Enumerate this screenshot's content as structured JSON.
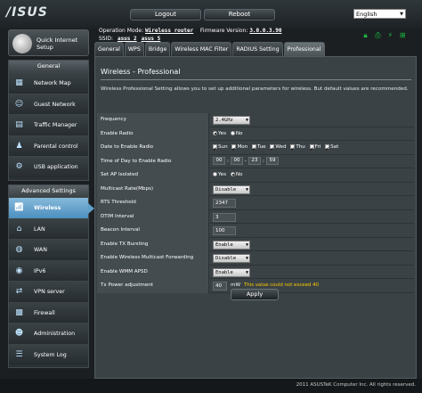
{
  "header": {
    "logo": "/ISUS",
    "logout_label": "Logout",
    "reboot_label": "Reboot",
    "language": "English",
    "operation_mode_label": "Operation Mode:",
    "operation_mode_value": "Wireless router",
    "firmware_label": "Firmware Version:",
    "firmware_value": "3.0.0.3.90",
    "ssid_label": "SSID:",
    "ssid_1": "asus_2",
    "ssid_2": "asus_5",
    "status_icons": [
      "lock-icon",
      "printer-icon",
      "usb-icon",
      "network-icon"
    ]
  },
  "sidebar": {
    "qis_label": "Quick Internet Setup",
    "general_title": "General",
    "general_items": [
      {
        "label": "Network Map",
        "icon": "network-map-icon"
      },
      {
        "label": "Guest Network",
        "icon": "guest-network-icon"
      },
      {
        "label": "Traffic Manager",
        "icon": "traffic-manager-icon"
      },
      {
        "label": "Parental control",
        "icon": "parental-control-icon"
      },
      {
        "label": "USB application",
        "icon": "usb-application-icon"
      }
    ],
    "advanced_title": "Advanced Settings",
    "advanced_items": [
      {
        "label": "Wireless",
        "icon": "wireless-icon",
        "active": true
      },
      {
        "label": "LAN",
        "icon": "lan-icon"
      },
      {
        "label": "WAN",
        "icon": "wan-icon"
      },
      {
        "label": "IPv6",
        "icon": "ipv6-icon"
      },
      {
        "label": "VPN server",
        "icon": "vpn-server-icon"
      },
      {
        "label": "Firewall",
        "icon": "firewall-icon"
      },
      {
        "label": "Administration",
        "icon": "administration-icon"
      },
      {
        "label": "System Log",
        "icon": "system-log-icon"
      }
    ]
  },
  "tabs": [
    "General",
    "WPS",
    "Bridge",
    "Wireless MAC Filter",
    "RADIUS Setting",
    "Professional"
  ],
  "active_tab": "Professional",
  "panel": {
    "title": "Wireless - Professional",
    "description": "Wireless Professional Setting allows you to set up additional parameters for wireless. But default values are recommended.",
    "apply_label": "Apply"
  },
  "settings": {
    "frequency": {
      "label": "Frequency",
      "value": "2.4GHz"
    },
    "enable_radio": {
      "label": "Enable Radio",
      "yes": "Yes",
      "no": "No",
      "selected": "Yes"
    },
    "date_enable": {
      "label": "Date to Enable Radio",
      "days": [
        "Sun",
        "Mon",
        "Tue",
        "Wed",
        "Thu",
        "Fri",
        "Sat"
      ]
    },
    "time_enable": {
      "label": "Time of Day to Enable Radio",
      "start_h": "00",
      "start_m": "00",
      "end_h": "23",
      "end_m": "59"
    },
    "ap_isolated": {
      "label": "Set AP Isolated",
      "yes": "Yes",
      "no": "No",
      "selected": "No"
    },
    "multicast_rate": {
      "label": "Multicast Rate(Mbps)",
      "value": "Disable"
    },
    "rts_threshold": {
      "label": "RTS Threshold",
      "value": "2347"
    },
    "dtim_interval": {
      "label": "DTIM Interval",
      "value": "3"
    },
    "beacon_interval": {
      "label": "Beacon Interval",
      "value": "100"
    },
    "tx_bursting": {
      "label": "Enable TX Bursting",
      "value": "Enable"
    },
    "wireless_multicast": {
      "label": "Enable Wireless Multicast Forwarding",
      "value": "Disable"
    },
    "wmm_apsd": {
      "label": "Enable WMM APSD",
      "value": "Enable"
    },
    "tx_power": {
      "label": "Tx Power adjustment",
      "value": "40",
      "unit": "mW",
      "warning": "This value could not exceed 40"
    }
  },
  "footer": {
    "copyright": "2011 ASUSTeK Computer Inc. All rights reserved."
  },
  "colors": {
    "accent": "#5f9fca",
    "warning": "#ffcc00",
    "status_green": "#19c243"
  }
}
